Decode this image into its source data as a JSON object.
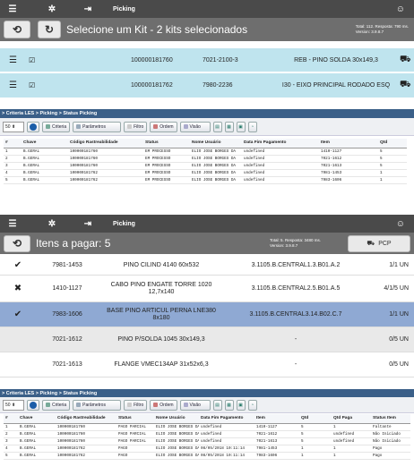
{
  "colors": {
    "topbar": "#4a4a4a",
    "subbar": "#6e6e6e",
    "kit_row": "#bfe4ee",
    "breadcrumb": "#3a5f88",
    "selected_row": "#8fa9d3",
    "alt_row": "#e9e9e9"
  },
  "screen1": {
    "title": "Picking",
    "subtitle": "Selecione um Kit - 2 kits selecionados",
    "status": "Total: 112. Resposta: 790 ms.",
    "version": "Version: 3.9.8.7",
    "kits": [
      {
        "code": "100000181760",
        "item": "7021-2100-3",
        "desc": "REB - PINO SOLDA 30x149,3"
      },
      {
        "code": "100000181762",
        "item": "7980-2236",
        "desc": "I30 - EIXO PRINCIPAL RODADO ESQ"
      }
    ]
  },
  "grid1": {
    "breadcrumb": "> Criteria LES > Picking > Status Picking",
    "page_size": "50",
    "buttons": {
      "criteria": "Criteria",
      "parametros": "Parâmetros",
      "filtro": "Filtro",
      "ordem": "Ordem",
      "visao": "Visão"
    },
    "columns": [
      "#",
      "Chave",
      "Código Rastreabilidade",
      "Status",
      "Nome Usuário",
      "Data Fim Pagamento",
      "Item",
      "Qtd"
    ],
    "rows": [
      [
        "1",
        "B.GERAL",
        "100000181760",
        "EM PROCESSO",
        "ELIO JOSE BORGES DA",
        "undefined",
        "1410-1127",
        "5"
      ],
      [
        "2",
        "B.GERAL",
        "100000181760",
        "EM PROCESSO",
        "ELIO JOSE BORGES DA",
        "undefined",
        "7021-1612",
        "5"
      ],
      [
        "3",
        "B.GERAL",
        "100000181760",
        "EM PROCESSO",
        "ELIO JOSE BORGES DA",
        "undefined",
        "7021-1613",
        "5"
      ],
      [
        "4",
        "B.GERAL",
        "100000181762",
        "EM PROCESSO",
        "ELIO JOSE BORGES DA",
        "undefined",
        "7981-1453",
        "1"
      ],
      [
        "5",
        "B.GERAL",
        "100000181762",
        "EM PROCESSO",
        "ELIO JOSE BORGES DA",
        "undefined",
        "7983-1606",
        "1"
      ]
    ]
  },
  "screen2": {
    "title": "Picking",
    "subtitle": "Itens a pagar: 5",
    "status": "Total: 5. Resposta: 3480 ms.",
    "version": "Version: 3.9.8.7",
    "pcp_label": "PCP",
    "items": [
      {
        "icon": "check",
        "item": "7981-1453",
        "desc": "PINO CILIND 4140 60x532",
        "loc": "3.1105.B.CENTRAL1.3.B01.A.2",
        "qty": "1/1 UN"
      },
      {
        "icon": "x",
        "item": "1410-1127",
        "desc": "CABO PINO ENGATE TORRE 1020 12,7x140",
        "loc": "3.1105.B.CENTRAL2.5.B01.A.5",
        "qty": "4/1/5 UN"
      },
      {
        "icon": "check",
        "item": "7983-1606",
        "desc": "BASE PINO ARTICUL PERNA LNE380 8x180",
        "loc": "3.1105.B.CENTRAL3.14.B02.C.7",
        "qty": "1/1 UN"
      },
      {
        "icon": "",
        "item": "7021-1612",
        "desc": "PINO P/SOLDA 1045 30x149,3",
        "loc": "-",
        "qty": "0/5 UN"
      },
      {
        "icon": "",
        "item": "7021-1613",
        "desc": "FLANGE VMEC134AP 31x52x6,3",
        "loc": "-",
        "qty": "0/5 UN"
      }
    ]
  },
  "grid2": {
    "breadcrumb": "> Criteria LES > Picking > Status Picking",
    "page_size": "50",
    "buttons": {
      "criteria": "Criteria",
      "parametros": "Parâmetros",
      "filtro": "Filtro",
      "ordem": "Ordem",
      "visao": "Visão"
    },
    "columns": [
      "#",
      "Chave",
      "Código Rastreabilidade",
      "Status",
      "Nome Usuário",
      "Data Fim Pagamento",
      "Item",
      "Qtd",
      "Qtd Paga",
      "Status Item"
    ],
    "rows": [
      [
        "1",
        "B.GERAL",
        "100000181760",
        "PAGO PARCIAL",
        "ELIO JOSE BORGES DA",
        "undefined",
        "1410-1127",
        "5",
        "1",
        "Faltante"
      ],
      [
        "2",
        "B.GERAL",
        "100000181760",
        "PAGO PARCIAL",
        "ELIO JOSE BORGES DA",
        "undefined",
        "7021-1612",
        "5",
        "undefined",
        "Não Iniciado"
      ],
      [
        "3",
        "B.GERAL",
        "100000181760",
        "PAGO PARCIAL",
        "ELIO JOSE BORGES DA",
        "undefined",
        "7021-1613",
        "5",
        "undefined",
        "Não Iniciado"
      ],
      [
        "4",
        "B.GERAL",
        "100000181762",
        "PAGO",
        "ELIO JOSE BORGES DA",
        "08/05/2018 10:11:14",
        "7981-1453",
        "1",
        "1",
        "Pago"
      ],
      [
        "5",
        "B.GERAL",
        "100000181762",
        "PAGO",
        "ELIO JOSE BORGES DA",
        "08/05/2018 10:11:14",
        "7983-1606",
        "1",
        "1",
        "Pago"
      ]
    ]
  }
}
